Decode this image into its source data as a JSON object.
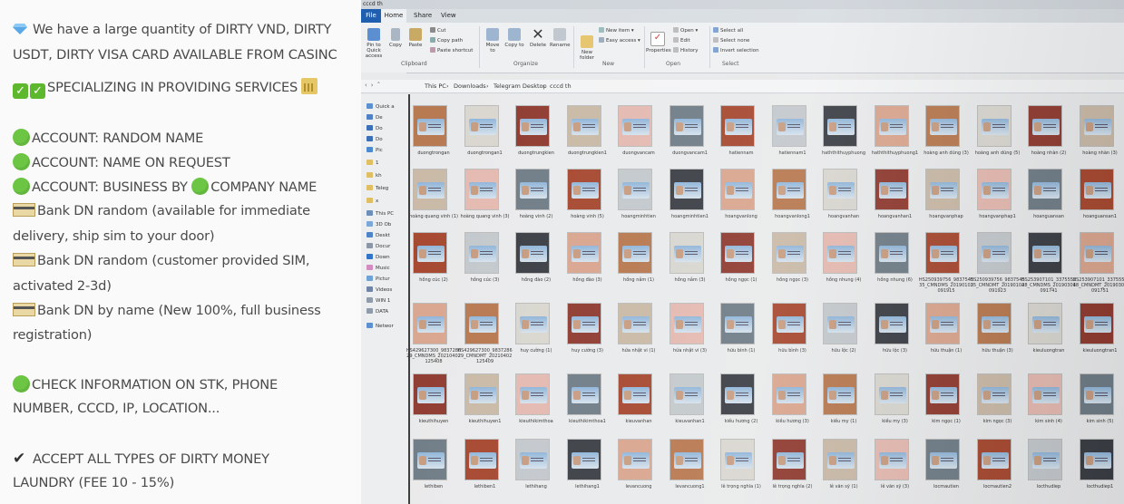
{
  "promo": {
    "lines": [
      "We have a large quantity of DIRTY VND, DIRTY",
      "USDT, DIRTY VISA CARD AVAILABLE FROM CASINC",
      "SPECIALIZING IN PROVIDING SERVICES",
      "ACCOUNT: RANDOM NAME",
      "ACCOUNT: NAME ON REQUEST",
      "ACCOUNT: BUSINESS BY",
      "COMPANY NAME",
      "Bank DN random (available for immediate",
      "delivery, ship sim to your door)",
      "Bank DN random (customer provided SIM,",
      "activated 2-3d)",
      "Bank DN by name (New 100%, full business",
      "registration)",
      "CHECK INFORMATION ON STK, PHONE",
      "NUMBER, CCCD, IP, LOCATION...",
      "ACCEPT ALL TYPES OF DIRTY MONEY",
      "LAUNDRY (FEE 10 - 15%)"
    ]
  },
  "explorer": {
    "window_title": "cccd th",
    "tabs": [
      "File",
      "Home",
      "Share",
      "View"
    ],
    "ribbon": {
      "pin": "Pin to Quick access",
      "copy": "Copy",
      "paste": "Paste",
      "cut": "Cut",
      "copy_path": "Copy path",
      "paste_shortcut": "Paste shortcut",
      "clipboard": "Clipboard",
      "move_to": "Move to",
      "copy_to": "Copy to",
      "delete": "Delete",
      "rename": "Rename",
      "organize": "Organize",
      "new_folder": "New folder",
      "new_item": "New item",
      "easy_access": "Easy access",
      "new": "New",
      "properties": "Properties",
      "open": "Open",
      "edit": "Edit",
      "history": "History",
      "open_group": "Open",
      "select_all": "Select all",
      "select_none": "Select none",
      "invert_selection": "Invert selection",
      "select": "Select"
    },
    "breadcrumb": [
      "This PC",
      "Downloads",
      "Telegram Desktop",
      "cccd th"
    ],
    "nav": [
      "Quick a",
      "De",
      "Do",
      "Do",
      "Pic",
      "1",
      "kh",
      "Teleg",
      "x",
      "This PC",
      "3D Ob",
      "Deskt",
      "Docur",
      "Down",
      "Music",
      "Pictur",
      "Videos",
      "WIN 1",
      "DATA",
      "Networ"
    ],
    "rows": [
      [
        "duongtrongan",
        "duongtrongan1",
        "duongtrungkien",
        "duongtrungkien1",
        "duongvancam",
        "duongvancam1",
        "hatiennam",
        "hatiennam1",
        "haththithuyphuong",
        "haththithuyphuong1",
        "hoàng anh dũng (3)",
        "hoàng anh dũng (5)",
        "hoàng nhàn (2)",
        "hoàng nhàn (3)"
      ],
      [
        "hoàng quang vinh (1)",
        "hoàng quang vinh (3)",
        "hoàng vinh (2)",
        "hoàng vinh (5)",
        "hoangminhtien",
        "hoangminhtien1",
        "hoangvanlong",
        "hoangvanlong1",
        "hoangvanhan",
        "hoangvanhan1",
        "hoangvanphap",
        "hoangvanphap1",
        "hoanguansan",
        "hoanguansan1"
      ],
      [
        "hồng cúc (2)",
        "hồng cúc (3)",
        "hồng đào (2)",
        "hồng đào (3)",
        "hồng nắm (1)",
        "hồng nắm (3)",
        "hồng ngọc (1)",
        "hồng ngọc (3)",
        "hồng nhung (4)",
        "hồng nhung (6)",
        "HS250939756_983754535_CMNDMS_20190102091915",
        "HS250939756_983754535_CMNDMT_20190102091923",
        "HS253907101_337555248_CMNDMS_20190301091741",
        "HS253907101_337555248_CMNDMT_20190301091751"
      ],
      [
        "HS429627300_983728629_CMNDMS_20210402125408",
        "HS429627300_983728629_CMNDMT_20210402125409",
        "huy cường (1)",
        "huy cường (3)",
        "hứa nhật vi (1)",
        "hứa nhật vi (3)",
        "hữu bình (1)",
        "hữu bình (3)",
        "hữu lộc (2)",
        "hữu lộc (3)",
        "hữu thuận (1)",
        "hữu thuận (3)",
        "kieuluongtran",
        "kieuluongtran1"
      ],
      [
        "kieuthihuyen",
        "kieuthihuyen1",
        "kieuthikimthoa",
        "kieuthikimthoa1",
        "kieuvanhan",
        "kieuvanhan1",
        "kiều hương (2)",
        "kiều hương (3)",
        "kiều my (1)",
        "kiều my (3)",
        "kim ngọc (1)",
        "kim ngọc (3)",
        "kim sinh (4)",
        "kim sinh (5)"
      ],
      [
        "lethiben",
        "lethiben1",
        "lethihang",
        "lethihang1",
        "levancuong",
        "levancuong1",
        "lê trọng nghĩa (1)",
        "lê trọng nghĩa (2)",
        "lê văn sỹ (1)",
        "lê văn sỹ (3)",
        "locmautien",
        "locmautien2",
        "locthudiep",
        "locthudiep1"
      ]
    ]
  }
}
